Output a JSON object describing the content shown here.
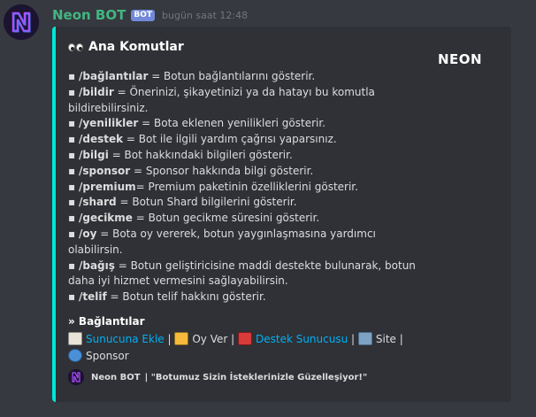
{
  "message": {
    "author": "Neon BOT",
    "bot_tag": "BOT",
    "timestamp": "bugün saat 12:48"
  },
  "embed": {
    "accent_color": "#00e6d6",
    "title": "Ana Komutlar",
    "title_icon": "eyes-emoji",
    "thumbnail_text": "NEON",
    "commands": [
      {
        "cmd": "/bağlantılar",
        "text": " = Botun bağlantılarını gösterir."
      },
      {
        "cmd": "/bildir",
        "text": " = Önerinizi, şikayetinizi ya da hatayı bu komutla",
        "cont": "bildirebilirsiniz."
      },
      {
        "cmd": "/yenilikler",
        "text": " = Bota eklenen yenilikleri gösterir."
      },
      {
        "cmd": "/destek",
        "text": " = Bot ile ilgili yardım çağrısı yaparsınız."
      },
      {
        "cmd": "/bilgi",
        "text": " = Bot hakkındaki bilgileri gösterir."
      },
      {
        "cmd": "/sponsor",
        "text": " = Sponsor hakkında bilgi gösterir."
      },
      {
        "cmd": "/premium",
        "text": "= Premium paketinin özelliklerini gösterir."
      },
      {
        "cmd": "/shard",
        "text": " = Botun Shard bilgilerini gösterir."
      },
      {
        "cmd": "/gecikme",
        "text": " = Botun gecikme süresini gösterir."
      },
      {
        "cmd": "/oy",
        "text": " = Bota oy vererek, botun yaygınlaşmasına yardımcı",
        "cont": "olabilirsin."
      },
      {
        "cmd": "/bağış",
        "text": " = Botun geliştiricisine maddi destekte bulunarak, botun",
        "cont": "daha iyi hizmet vermesini sağlayabilirsin."
      },
      {
        "cmd": "/telif",
        "text": " = Botun telif hakkını gösterir."
      }
    ],
    "bullet": "▪",
    "field_name": "» Bağlantılar",
    "links": {
      "invite": "Sunucuna Ekle",
      "sep": " | ",
      "vote": "Oy Ver",
      "support": "Destek Sunucusu",
      "site": "Site",
      "sponsor": "Sponsor"
    },
    "footer": {
      "name": "Neon BOT",
      "text": "| \"Botumuz Sizin İsteklerinizle Güzelleşiyor!\""
    }
  }
}
